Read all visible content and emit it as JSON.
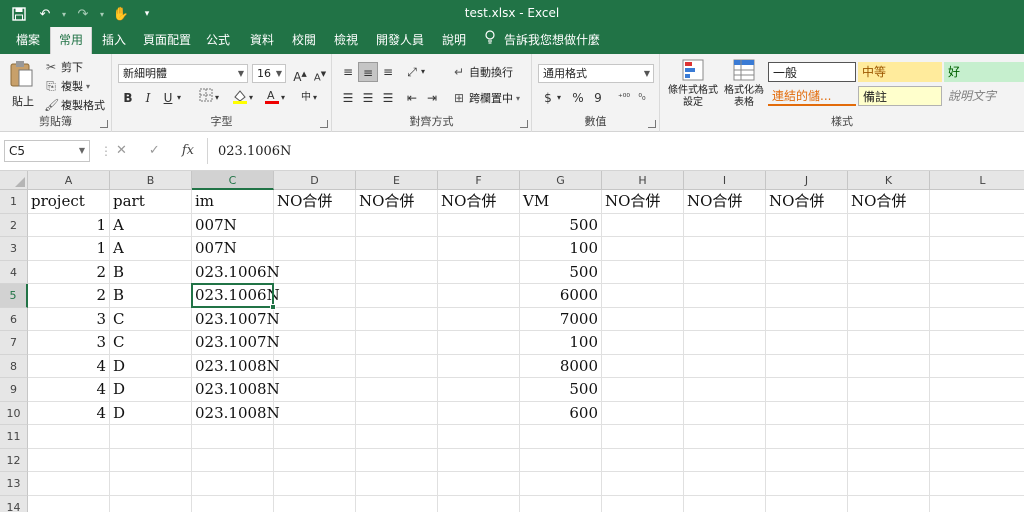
{
  "title": {
    "text": "test.xlsx  -  Excel"
  },
  "qat": {
    "save_icon": "save-icon",
    "undo_icon": "undo-icon",
    "redo_icon": "redo-icon",
    "touch_icon": "touch-mode-icon",
    "customize_icon": "customize-icon"
  },
  "tabs": [
    "檔案",
    "常用",
    "插入",
    "頁面配置",
    "公式",
    "資料",
    "校閱",
    "檢視",
    "開發人員",
    "說明"
  ],
  "active_tab": "常用",
  "tell_me": "告訴我您想做什麼",
  "ribbon": {
    "clipboard": {
      "label": "剪貼簿",
      "paste": "貼上",
      "cut": "剪下",
      "copy": "複製",
      "format_painter": "複製格式"
    },
    "font": {
      "label": "字型",
      "font_name": "新細明體",
      "font_size": "16"
    },
    "alignment": {
      "label": "對齊方式",
      "wrap_text": "自動換行",
      "merge_center": "跨欄置中"
    },
    "number": {
      "label": "數值",
      "format": "通用格式",
      "currency": "$",
      "percent": "%",
      "comma": "9"
    },
    "styles": {
      "label": "樣式",
      "conditional_formatting": "條件式格式\n設定",
      "format_as_table": "格式化為\n表格",
      "normal": "一般",
      "neutral": "中等",
      "good": "好",
      "hyperlink": "連結的儲...",
      "note": "備註",
      "explanatory": "說明文字"
    }
  },
  "formula_bar": {
    "name_box": "C5",
    "content": "023.1006N"
  },
  "columns": [
    "A",
    "B",
    "C",
    "D",
    "E",
    "F",
    "G",
    "H",
    "I",
    "J",
    "K",
    "L"
  ],
  "rows": [
    "1",
    "2",
    "3",
    "4",
    "5",
    "6",
    "7",
    "8",
    "9",
    "10",
    "11",
    "12",
    "13",
    "14"
  ],
  "selected": {
    "column": "C",
    "row": "5"
  },
  "cells": [
    [
      "project",
      "part",
      "im",
      "NO合併",
      "NO合併",
      "NO合併",
      "VM",
      "NO合併",
      "NO合併",
      "NO合併",
      "NO合併",
      ""
    ],
    [
      "1",
      "A",
      "007N",
      "",
      "",
      "",
      "500",
      "",
      "",
      "",
      "",
      ""
    ],
    [
      "1",
      "A",
      "007N",
      "",
      "",
      "",
      "100",
      "",
      "",
      "",
      "",
      ""
    ],
    [
      "2",
      "B",
      "023.1006N",
      "",
      "",
      "",
      "500",
      "",
      "",
      "",
      "",
      ""
    ],
    [
      "2",
      "B",
      "023.1006N",
      "",
      "",
      "",
      "6000",
      "",
      "",
      "",
      "",
      ""
    ],
    [
      "3",
      "C",
      "023.1007N",
      "",
      "",
      "",
      "7000",
      "",
      "",
      "",
      "",
      ""
    ],
    [
      "3",
      "C",
      "023.1007N",
      "",
      "",
      "",
      "100",
      "",
      "",
      "",
      "",
      ""
    ],
    [
      "4",
      "D",
      "023.1008N",
      "",
      "",
      "",
      "8000",
      "",
      "",
      "",
      "",
      ""
    ],
    [
      "4",
      "D",
      "023.1008N",
      "",
      "",
      "",
      "500",
      "",
      "",
      "",
      "",
      ""
    ],
    [
      "4",
      "D",
      "023.1008N",
      "",
      "",
      "",
      "600",
      "",
      "",
      "",
      "",
      ""
    ],
    [
      "",
      "",
      "",
      "",
      "",
      "",
      "",
      "",
      "",
      "",
      "",
      ""
    ],
    [
      "",
      "",
      "",
      "",
      "",
      "",
      "",
      "",
      "",
      "",
      "",
      ""
    ],
    [
      "",
      "",
      "",
      "",
      "",
      "",
      "",
      "",
      "",
      "",
      "",
      ""
    ],
    [
      "",
      "",
      "",
      "",
      "",
      "",
      "",
      "",
      "",
      "",
      "",
      ""
    ]
  ],
  "colors": {
    "brand": "#217346",
    "ribbon": "#f3f3f3",
    "neutral_bg": "#ffeb9c",
    "good_bg": "#c6efce",
    "note_bg": "#ffffcc",
    "hyperlink": "#e26b0a"
  }
}
